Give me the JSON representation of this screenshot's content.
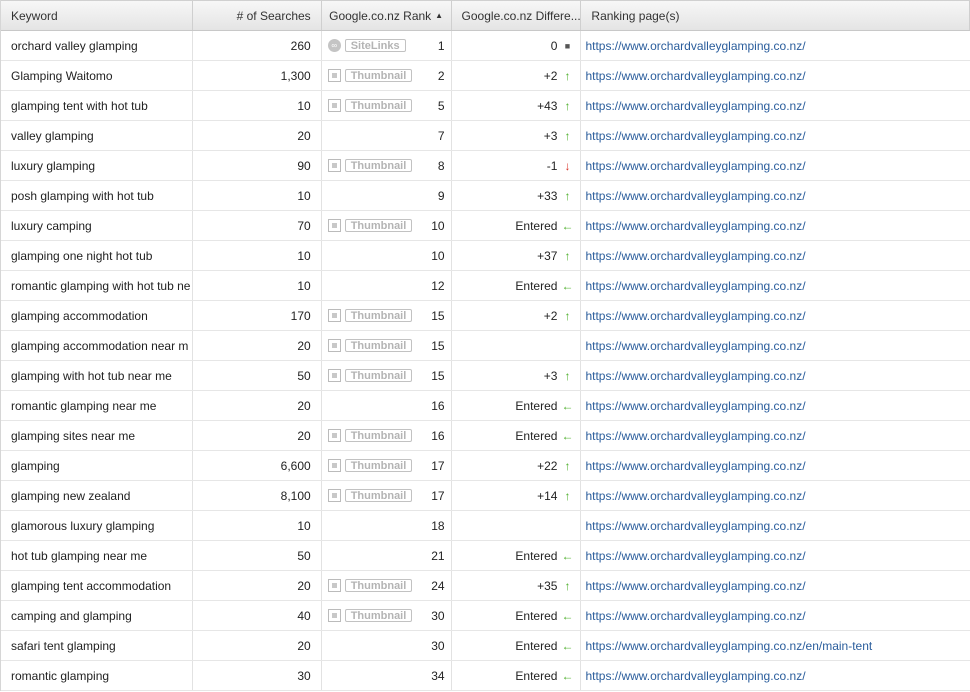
{
  "columns": {
    "keyword": "Keyword",
    "searches": "# of Searches",
    "rank": "Google.co.nz Rank",
    "difference": "Google.co.nz Differe...",
    "page": "Ranking page(s)"
  },
  "badge_labels": {
    "sitelinks": "SiteLinks",
    "thumbnail": "Thumbnail"
  },
  "colors": {
    "link": "#2a5d9c",
    "up": "#4caf2a",
    "down": "#d9352a"
  },
  "rows": [
    {
      "keyword": "orchard valley glamping",
      "searches": "260",
      "badge": "sitelinks",
      "rank": "1",
      "diff": "0",
      "trend": "same",
      "url": "https://www.orchardvalleyglamping.co.nz/"
    },
    {
      "keyword": "Glamping Waitomo",
      "searches": "1,300",
      "badge": "thumbnail",
      "rank": "2",
      "diff": "+2",
      "trend": "up",
      "url": "https://www.orchardvalleyglamping.co.nz/"
    },
    {
      "keyword": "glamping tent with hot tub",
      "searches": "10",
      "badge": "thumbnail",
      "rank": "5",
      "diff": "+43",
      "trend": "up",
      "url": "https://www.orchardvalleyglamping.co.nz/"
    },
    {
      "keyword": "valley glamping",
      "searches": "20",
      "badge": "",
      "rank": "7",
      "diff": "+3",
      "trend": "up",
      "url": "https://www.orchardvalleyglamping.co.nz/"
    },
    {
      "keyword": "luxury glamping",
      "searches": "90",
      "badge": "thumbnail",
      "rank": "8",
      "diff": "-1",
      "trend": "down",
      "url": "https://www.orchardvalleyglamping.co.nz/"
    },
    {
      "keyword": "posh glamping with hot tub",
      "searches": "10",
      "badge": "",
      "rank": "9",
      "diff": "+33",
      "trend": "up",
      "url": "https://www.orchardvalleyglamping.co.nz/"
    },
    {
      "keyword": "luxury camping",
      "searches": "70",
      "badge": "thumbnail",
      "rank": "10",
      "diff": "Entered",
      "trend": "entered",
      "url": "https://www.orchardvalleyglamping.co.nz/"
    },
    {
      "keyword": "glamping one night hot tub",
      "searches": "10",
      "badge": "",
      "rank": "10",
      "diff": "+37",
      "trend": "up",
      "url": "https://www.orchardvalleyglamping.co.nz/"
    },
    {
      "keyword": "romantic glamping with hot tub ne",
      "searches": "10",
      "badge": "",
      "rank": "12",
      "diff": "Entered",
      "trend": "entered",
      "url": "https://www.orchardvalleyglamping.co.nz/"
    },
    {
      "keyword": "glamping accommodation",
      "searches": "170",
      "badge": "thumbnail",
      "rank": "15",
      "diff": "+2",
      "trend": "up",
      "url": "https://www.orchardvalleyglamping.co.nz/"
    },
    {
      "keyword": "glamping accommodation near m",
      "searches": "20",
      "badge": "thumbnail",
      "rank": "15",
      "diff": "",
      "trend": "",
      "url": "https://www.orchardvalleyglamping.co.nz/"
    },
    {
      "keyword": "glamping with hot tub near me",
      "searches": "50",
      "badge": "thumbnail",
      "rank": "15",
      "diff": "+3",
      "trend": "up",
      "url": "https://www.orchardvalleyglamping.co.nz/"
    },
    {
      "keyword": "romantic glamping near me",
      "searches": "20",
      "badge": "",
      "rank": "16",
      "diff": "Entered",
      "trend": "entered",
      "url": "https://www.orchardvalleyglamping.co.nz/"
    },
    {
      "keyword": "glamping sites near me",
      "searches": "20",
      "badge": "thumbnail",
      "rank": "16",
      "diff": "Entered",
      "trend": "entered",
      "url": "https://www.orchardvalleyglamping.co.nz/"
    },
    {
      "keyword": "glamping",
      "searches": "6,600",
      "badge": "thumbnail",
      "rank": "17",
      "diff": "+22",
      "trend": "up",
      "url": "https://www.orchardvalleyglamping.co.nz/"
    },
    {
      "keyword": "glamping new zealand",
      "searches": "8,100",
      "badge": "thumbnail",
      "rank": "17",
      "diff": "+14",
      "trend": "up",
      "url": "https://www.orchardvalleyglamping.co.nz/"
    },
    {
      "keyword": "glamorous luxury glamping",
      "searches": "10",
      "badge": "",
      "rank": "18",
      "diff": "",
      "trend": "",
      "url": "https://www.orchardvalleyglamping.co.nz/"
    },
    {
      "keyword": "hot tub glamping near me",
      "searches": "50",
      "badge": "",
      "rank": "21",
      "diff": "Entered",
      "trend": "entered",
      "url": "https://www.orchardvalleyglamping.co.nz/"
    },
    {
      "keyword": "glamping tent accommodation",
      "searches": "20",
      "badge": "thumbnail",
      "rank": "24",
      "diff": "+35",
      "trend": "up",
      "url": "https://www.orchardvalleyglamping.co.nz/"
    },
    {
      "keyword": "camping and glamping",
      "searches": "40",
      "badge": "thumbnail",
      "rank": "30",
      "diff": "Entered",
      "trend": "entered",
      "url": "https://www.orchardvalleyglamping.co.nz/"
    },
    {
      "keyword": "safari tent glamping",
      "searches": "20",
      "badge": "",
      "rank": "30",
      "diff": "Entered",
      "trend": "entered",
      "url": "https://www.orchardvalleyglamping.co.nz/en/main-tent"
    },
    {
      "keyword": "romantic glamping",
      "searches": "30",
      "badge": "",
      "rank": "34",
      "diff": "Entered",
      "trend": "entered",
      "url": "https://www.orchardvalleyglamping.co.nz/"
    }
  ]
}
